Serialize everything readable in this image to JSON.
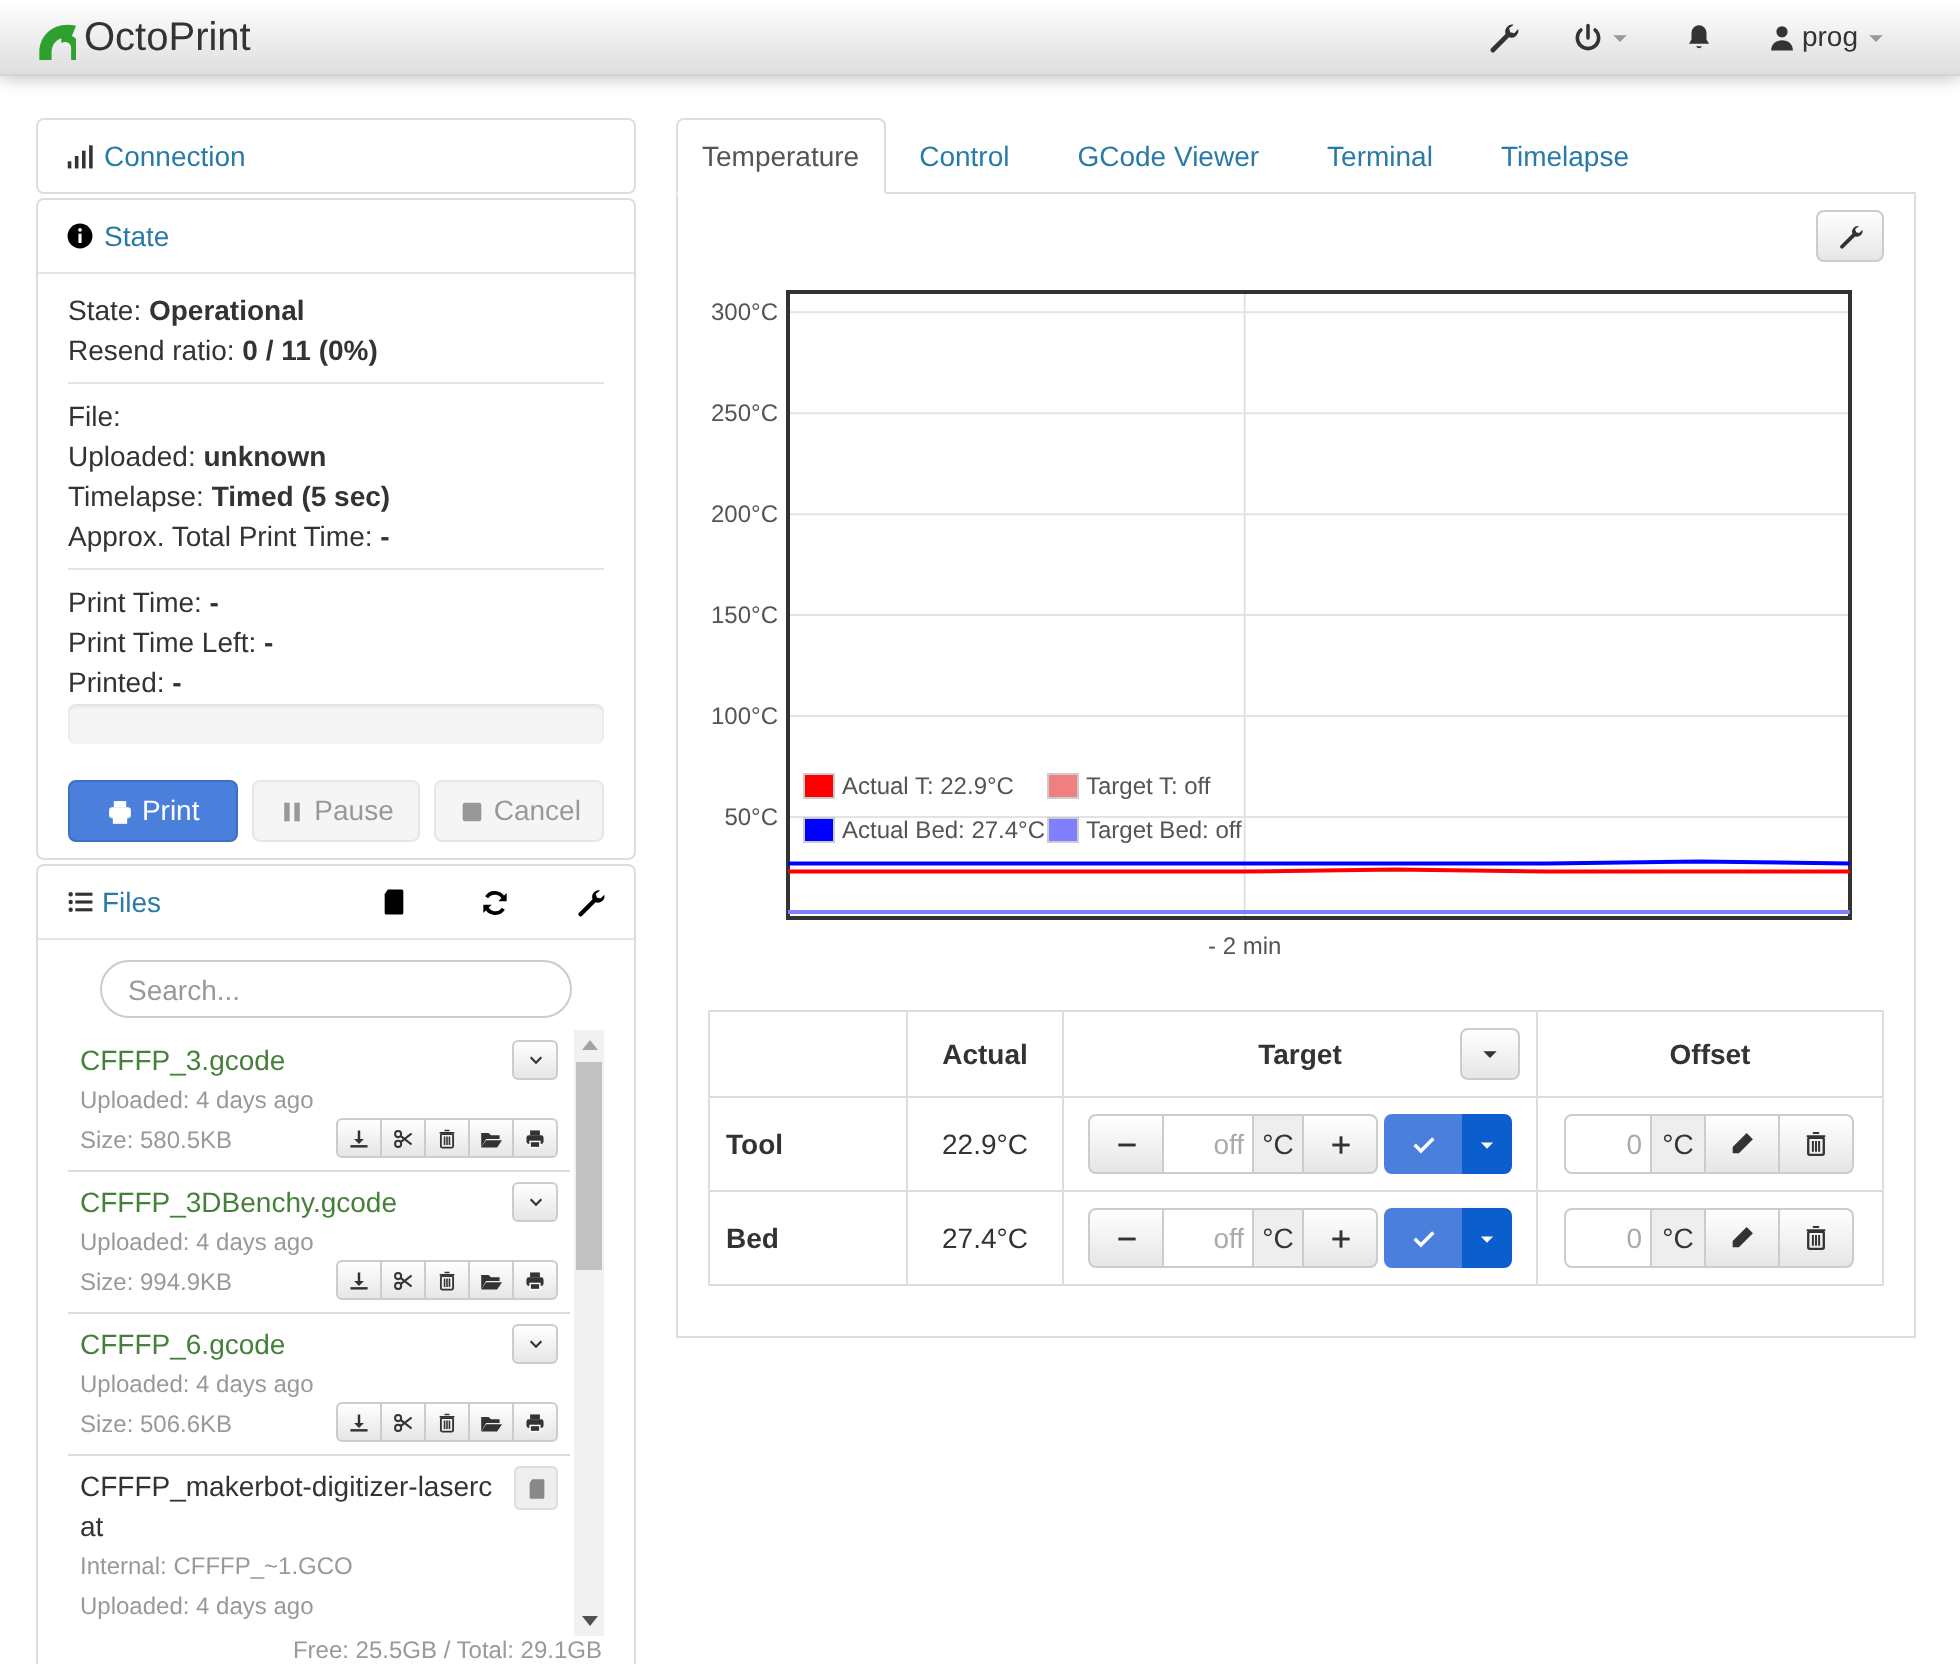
{
  "navbar": {
    "brand": "OctoPrint",
    "user": "prog"
  },
  "connection": {
    "title": "Connection"
  },
  "state": {
    "title": "State",
    "groups": [
      [
        "State: **Operational**",
        "Resend ratio: **0 / 11 (0%)**"
      ],
      [
        "File:",
        "Uploaded: **unknown**",
        "Timelapse: **Timed (5 sec)**",
        "Approx. Total Print Time: **-**"
      ],
      [
        "Print Time: **-**",
        "Print Time Left: **-**",
        "Printed: **-**"
      ]
    ],
    "progress": {
      "level": 0
    },
    "buttons": [
      {
        "kind": "print",
        "label": "Print",
        "disabled": false
      },
      {
        "kind": "pause",
        "label": "Pause",
        "disabled": true
      },
      {
        "kind": "cancel",
        "label": "Cancel",
        "disabled": true
      }
    ]
  },
  "files": {
    "title": "Files",
    "search": {
      "placeholder": "Search..."
    },
    "items": [
      {
        "kind": "local",
        "name": "CFFFP_3.gcode",
        "lines": [
          "Uploaded: 4 days ago",
          "Size: 580.5KB"
        ]
      },
      {
        "kind": "local",
        "name": "CFFFP_3DBenchy.gcode",
        "lines": [
          "Uploaded: 4 days ago",
          "Size: 994.9KB"
        ]
      },
      {
        "kind": "local",
        "name": "CFFFP_6.gcode",
        "lines": [
          "Uploaded: 4 days ago",
          "Size: 506.6KB"
        ]
      },
      {
        "kind": "sdcard",
        "name": "CFFFP_makerbot-digitizer-lasercat",
        "lines": [
          "Internal: CFFFP_~1.GCO",
          "Uploaded: 4 days ago"
        ]
      }
    ],
    "footer": "Free: 25.5GB / Total: 29.1GB"
  },
  "tabs": [
    {
      "label": "Temperature",
      "selected": true
    },
    {
      "label": "Control",
      "selected": false
    },
    {
      "label": "GCode Viewer",
      "selected": false
    },
    {
      "label": "Terminal",
      "selected": false
    },
    {
      "label": "Timelapse",
      "selected": false
    }
  ],
  "temperature": {
    "chart_data": {
      "type": "line",
      "annotations": [
        "- 2 min"
      ],
      "grid": true,
      "legend": true,
      "ylim": [
        0,
        310
      ],
      "yticks": [
        {
          "value": 50,
          "label": "50°C"
        },
        {
          "value": 100,
          "label": "100°C"
        },
        {
          "value": 150,
          "label": "150°C"
        },
        {
          "value": 200,
          "label": "200°C"
        },
        {
          "value": 250,
          "label": "250°C"
        },
        {
          "value": 300,
          "label": "300°C"
        }
      ],
      "series": [
        {
          "name": "Actual T: 22.9°C",
          "color": "#ff0000",
          "values": [
            23,
            23,
            23,
            23,
            24,
            23,
            23,
            23
          ]
        },
        {
          "name": "Target T: off",
          "color": "#f08080",
          "values": [
            null,
            null,
            null,
            null,
            null,
            null,
            null,
            null
          ]
        },
        {
          "name": "Actual Bed: 27.4°C",
          "color": "#0000ff",
          "values": [
            27,
            27,
            27,
            27,
            27,
            27,
            28,
            27
          ]
        },
        {
          "name": "Target Bed: off",
          "color": "#8080ff",
          "values": [
            3,
            3,
            3,
            3,
            3,
            3,
            3,
            3
          ]
        }
      ]
    },
    "table": {
      "columns": [
        "Actual",
        "Target",
        "Offset"
      ],
      "rows": [
        {
          "name": "Tool",
          "actual": "22.9°C",
          "target": {
            "placeholder": "off"
          },
          "unit": "°C",
          "offset": {
            "placeholder": "0"
          },
          "offset_unit": "°C"
        },
        {
          "name": "Bed",
          "actual": "27.4°C",
          "target": {
            "placeholder": "off"
          },
          "unit": "°C",
          "offset": {
            "placeholder": "0"
          },
          "offset_unit": "°C"
        }
      ]
    }
  }
}
